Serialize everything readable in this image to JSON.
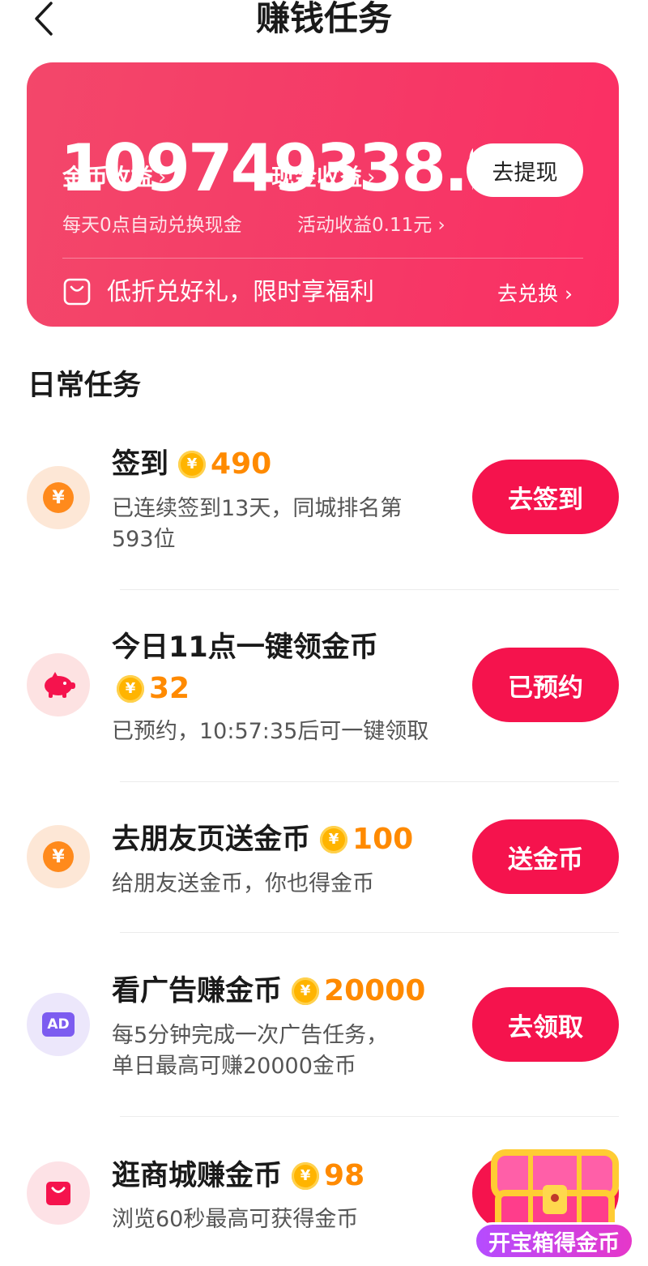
{
  "header": {
    "title": "赚钱任务",
    "back_icon": "chevron-left-icon"
  },
  "earnings_card": {
    "coin_label": "金币收益",
    "cash_label": "现金收益",
    "chevron": "›",
    "amount": "109749338.93",
    "withdraw_label": "去提现",
    "auto_exchange_note": "每天0点自动兑换现金",
    "activity_earnings": "活动收益0.11元 ›",
    "promo_text": "低折兑好礼，限时享福利",
    "exchange_link": "去兑换 ›",
    "colors": {
      "start": "#f3476a",
      "end": "#fb2e63"
    }
  },
  "section": {
    "title": "日常任务"
  },
  "tasks": [
    {
      "icon": "yuan-coin-icon",
      "title": "签到",
      "coin_symbol": "¥",
      "reward": "490",
      "desc_lines": [
        "已连续签到13天，同城排名第",
        "593位"
      ],
      "button": "去签到"
    },
    {
      "icon": "piggy-bank-icon",
      "title": "今日11点一键领金币",
      "coin_symbol": "¥",
      "reward": "32",
      "desc_lines": [
        "已预约，10:57:35后可一键领取"
      ],
      "button": "已预约"
    },
    {
      "icon": "yuan-coin-icon",
      "title": "去朋友页送金币",
      "coin_symbol": "¥",
      "reward": "100",
      "desc_lines": [
        "给朋友送金币，你也得金币"
      ],
      "button": "送金币"
    },
    {
      "icon": "ad-icon",
      "icon_text": "AD",
      "title": "看广告赚金币",
      "coin_symbol": "¥",
      "reward": "20000",
      "desc_lines": [
        "每5分钟完成一次广告任务，",
        "单日最高可赚20000金币"
      ],
      "button": "去领取"
    },
    {
      "icon": "shopping-bag-icon",
      "title": "逛商城赚金币",
      "coin_symbol": "¥",
      "reward": "98",
      "desc_lines": [
        "浏览60秒最高可获得金币"
      ],
      "button": ""
    }
  ],
  "treasure_box": {
    "label": "开宝箱得金币",
    "icon": "treasure-chest-icon"
  },
  "accent_color": "#f5134d",
  "reward_color": "#ff8a00"
}
